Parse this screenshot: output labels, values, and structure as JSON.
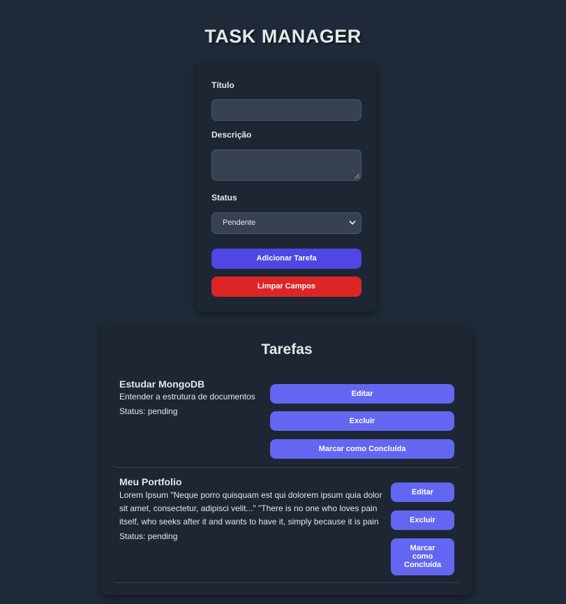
{
  "header": {
    "title": "TASK MANAGER"
  },
  "form": {
    "title_label": "Título",
    "title_value": "",
    "description_label": "Descrição",
    "description_value": "",
    "status_label": "Status",
    "status_selected": "Pendente",
    "add_button": "Adicionar Tarefa",
    "clear_button": "Limpar Campos"
  },
  "tasks": {
    "heading": "Tarefas",
    "items": [
      {
        "title": "Estudar MongoDB",
        "description": "Entender a estrutura de documentos",
        "status": "Status: pending",
        "edit_label": "Editar",
        "delete_label": "Excluir",
        "complete_label": "Marcar como Concluída"
      },
      {
        "title": "Meu Portfolio",
        "description_lines": [
          "Lorem Ipsum \"Neque porro quisquam est qui dolorem ipsum quia dolor",
          "sit amet, consectetur, adipisci velit...\" \"There is no one who loves pain",
          "itself, who seeks after it and wants to have it, simply because it is pain"
        ],
        "status": "Status: pending",
        "edit_label": "Editar",
        "delete_label": "Excluir",
        "complete_label_lines": [
          "Marcar",
          "como",
          "Concluída"
        ]
      }
    ]
  },
  "colors": {
    "background": "#1f2937",
    "card": "#1e2634",
    "primary": "#4f46e5",
    "danger": "#dc2626",
    "task_button": "#6366f1"
  }
}
